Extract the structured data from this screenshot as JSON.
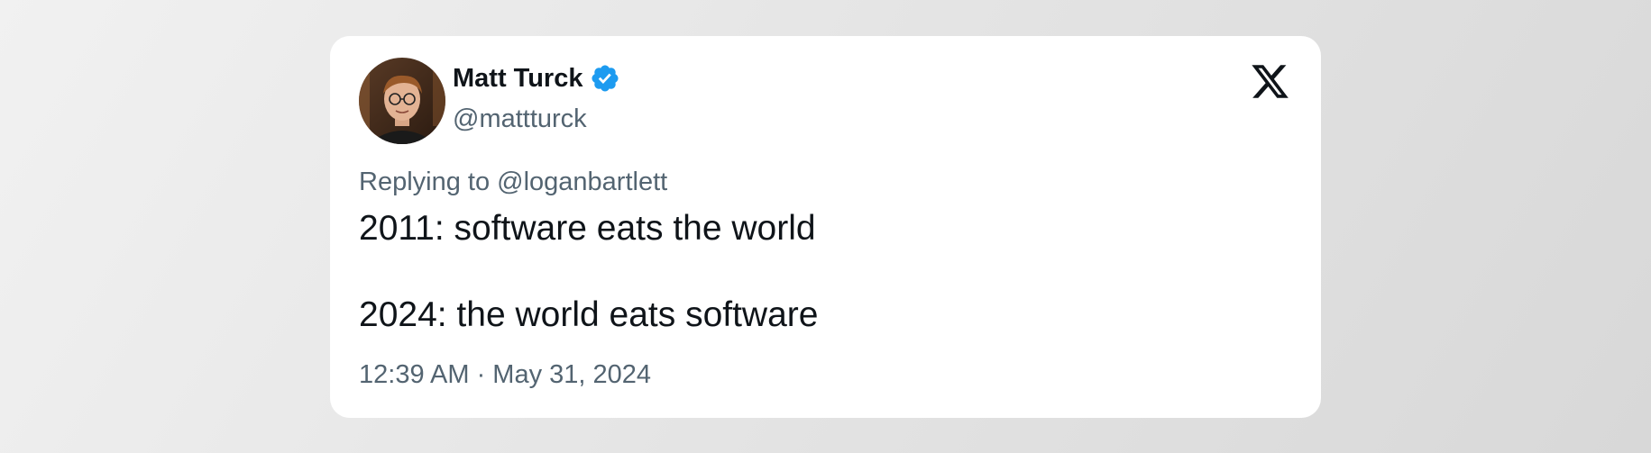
{
  "tweet": {
    "author_name": "Matt Turck",
    "handle": "@mattturck",
    "replying_to": "Replying to @loganbartlett",
    "lines": [
      "2011: software eats the world",
      "2024: the world eats software"
    ],
    "timestamp": "12:39 AM · May 31, 2024"
  },
  "icons": {
    "verified": "verified-badge-icon",
    "platform": "x-logo-icon"
  },
  "colors": {
    "verified": "#1d9bf0",
    "primary_text": "#0f1419",
    "secondary_text": "#536471"
  }
}
